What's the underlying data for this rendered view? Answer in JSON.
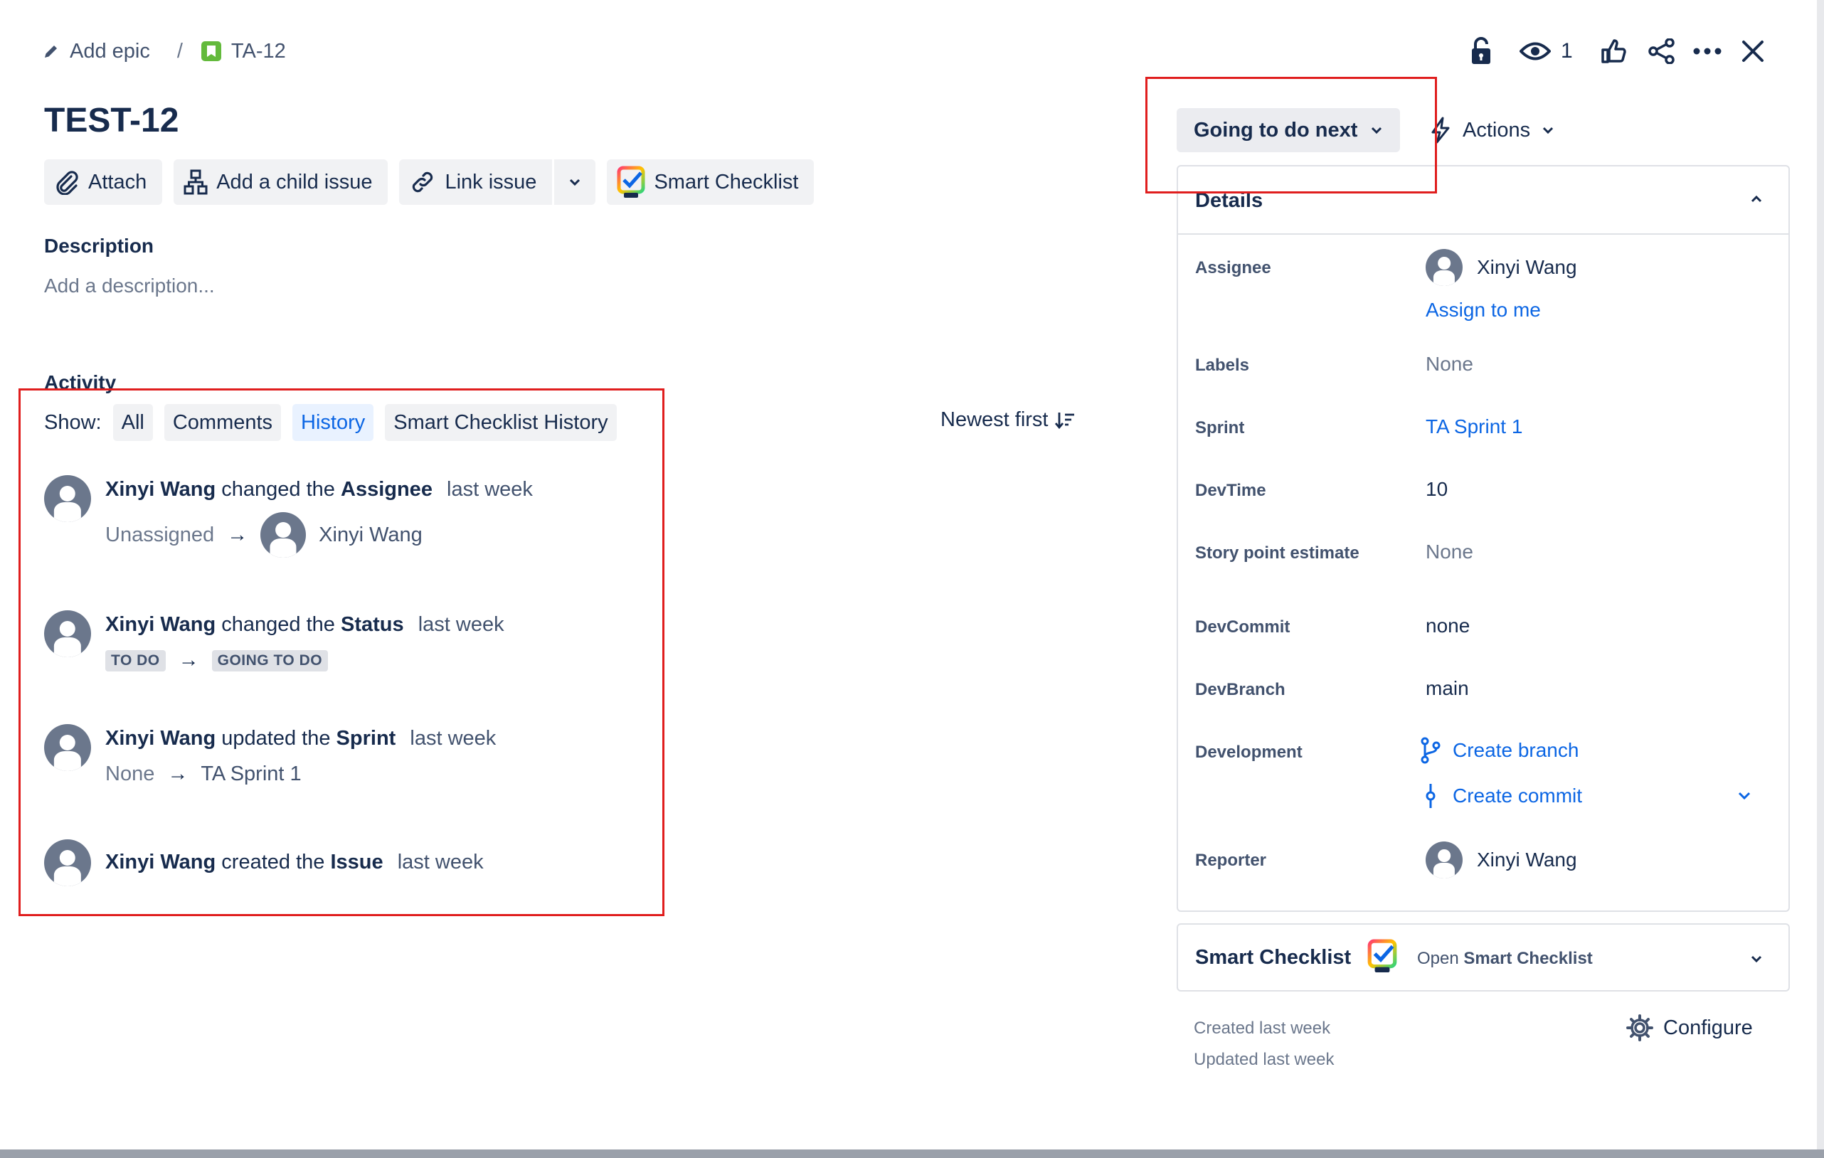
{
  "breadcrumb": {
    "add_epic": "Add epic",
    "separator": "/",
    "issue_key": "TA-12"
  },
  "toolbar": {
    "watch_count": "1"
  },
  "issue": {
    "title": "TEST-12"
  },
  "buttons": {
    "attach": "Attach",
    "add_child": "Add a child issue",
    "link_issue": "Link issue",
    "smart_checklist": "Smart Checklist"
  },
  "description": {
    "label": "Description",
    "placeholder": "Add a description..."
  },
  "activity": {
    "label": "Activity",
    "show_label": "Show:",
    "filters": [
      "All",
      "Comments",
      "History",
      "Smart Checklist History"
    ],
    "active_filter": "History",
    "sort": "Newest first",
    "items": [
      {
        "user": "Xinyi Wang",
        "action": "changed the",
        "field": "Assignee",
        "time": "last week",
        "from": "Unassigned",
        "to": "Xinyi Wang"
      },
      {
        "user": "Xinyi Wang",
        "action": "changed the",
        "field": "Status",
        "time": "last week",
        "from": "TO DO",
        "to": "GOING TO DO"
      },
      {
        "user": "Xinyi Wang",
        "action": "updated the",
        "field": "Sprint",
        "time": "last week",
        "from": "None",
        "to": "TA Sprint 1"
      },
      {
        "user": "Xinyi Wang",
        "action": "created the",
        "field": "Issue",
        "time": "last week"
      }
    ]
  },
  "status": {
    "current": "Going to do next",
    "actions": "Actions"
  },
  "details": {
    "title": "Details",
    "assignee_label": "Assignee",
    "assignee": "Xinyi Wang",
    "assign_to_me": "Assign to me",
    "labels_label": "Labels",
    "labels": "None",
    "sprint_label": "Sprint",
    "sprint": "TA Sprint 1",
    "devtime_label": "DevTime",
    "devtime": "10",
    "story_label": "Story point estimate",
    "story": "None",
    "devcommit_label": "DevCommit",
    "devcommit": "none",
    "devbranch_label": "DevBranch",
    "devbranch": "main",
    "development_label": "Development",
    "create_branch": "Create branch",
    "create_commit": "Create commit",
    "reporter_label": "Reporter",
    "reporter": "Xinyi Wang"
  },
  "smart_checklist_panel": {
    "title": "Smart Checklist",
    "open_prefix": "Open",
    "open_name": "Smart Checklist"
  },
  "meta": {
    "created": "Created last week",
    "updated": "Updated last week",
    "configure": "Configure"
  },
  "colors": {
    "link": "#0c66e4",
    "highlight_box": "#e01e1e",
    "epic_badge": "#63ba3c"
  }
}
